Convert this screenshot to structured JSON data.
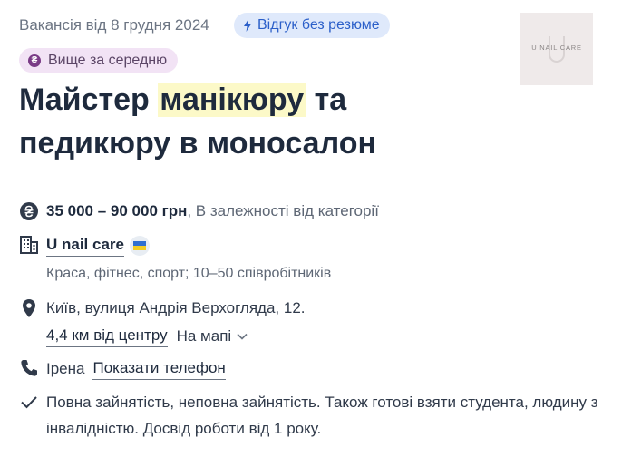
{
  "vacancy": {
    "date_label": "Вакансія від 8 грудня 2024",
    "no_resume_badge": "Відгук без резюме",
    "salary_badge": "Вище за середню",
    "title_part1": "Майстер ",
    "title_highlight": "манікюру",
    "title_part2": " та педикюру в моносалон"
  },
  "salary": {
    "range": "35 000 – 90 000 грн",
    "note": ", В залежності від категорії"
  },
  "company": {
    "name": "U nail care",
    "details": "Краса, фітнес, спорт; 10–50 співробітників",
    "logo_text": "U NAIL CARE"
  },
  "location": {
    "address": "Київ, вулиця Андрія Верхогляда, 12.",
    "distance": "4,4 км від центру",
    "map_toggle": "На мапі"
  },
  "contact": {
    "name": "Ірена",
    "show_phone": "Показати телефон"
  },
  "conditions": {
    "line1": "Повна зайнятість, неповна зайнятість. Також готові взяти студента, людину з",
    "line2": "інвалідністю. Досвід роботи від 1 року."
  },
  "colors": {
    "accent_blue": "#2b5fc9",
    "salary_purple": "#7a3b86",
    "title_highlight": "#fcf9c8"
  },
  "icons": {
    "salary": "hryvnia-icon",
    "company": "building-icon",
    "location": "map-pin-icon",
    "contact": "phone-icon",
    "conditions": "check-icon"
  }
}
